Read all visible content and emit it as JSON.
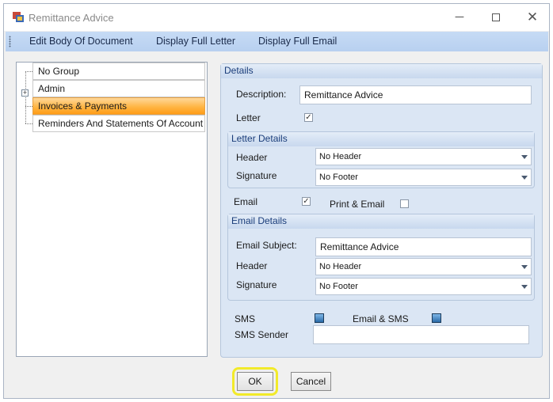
{
  "window": {
    "title": "Remittance Advice",
    "minimize_glyph": "─",
    "close_glyph": "✕"
  },
  "toolbar": {
    "items": [
      "Edit Body Of Document",
      "Display Full Letter",
      "Display Full Email"
    ]
  },
  "tree": {
    "expander_glyph": "+",
    "items": [
      {
        "label": "No Group"
      },
      {
        "label": "Admin"
      },
      {
        "label": "Invoices & Payments"
      },
      {
        "label": "Reminders And Statements Of Account"
      }
    ],
    "selected_index": 2
  },
  "details": {
    "header": "Details",
    "description_label": "Description:",
    "description_value": "Remittance Advice",
    "letter_label": "Letter",
    "letter_checked": true,
    "letter_details": {
      "header": "Letter Details",
      "header_label": "Header",
      "header_value": "No Header",
      "signature_label": "Signature",
      "signature_value": "No Footer"
    },
    "email_label": "Email",
    "email_checked": true,
    "print_email_label": "Print & Email",
    "print_email_checked": false,
    "email_details": {
      "header": "Email Details",
      "subject_label": "Email Subject:",
      "subject_value": "Remittance Advice",
      "header_label": "Header",
      "header_value": "No Header",
      "signature_label": "Signature",
      "signature_value": "No Footer"
    },
    "sms_label": "SMS",
    "email_sms_label": "Email & SMS",
    "sms_sender_label": "SMS Sender",
    "sms_sender_value": ""
  },
  "check_glyph": "✓",
  "buttons": {
    "ok": "OK",
    "cancel": "Cancel"
  },
  "colors": {
    "selected_row": "#ffb545",
    "toolbar": "#c6dbf5",
    "details_bg": "#dbe6f4",
    "highlight": "#f2ea2a"
  }
}
